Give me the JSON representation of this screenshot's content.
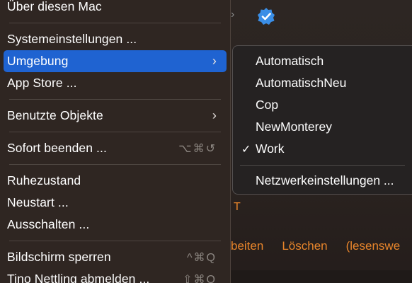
{
  "apple_menu": {
    "about": "Über diesen Mac",
    "system_settings": "Systemeinstellungen ...",
    "location": "Umgebung",
    "app_store": "App Store ...",
    "recent_items": "Benutzte Objekte",
    "force_quit": "Sofort beenden ...",
    "force_quit_shortcut": "⌥⌘↺",
    "sleep": "Ruhezustand",
    "restart": "Neustart ...",
    "shut_down": "Ausschalten ...",
    "lock_screen": "Bildschirm sperren",
    "lock_screen_shortcut": "^⌘Q",
    "log_out": "Tino Nettling abmelden ...",
    "log_out_shortcut": "⇧⌘Q"
  },
  "location_submenu": {
    "items": [
      "Automatisch",
      "AutomatischNeu",
      "Cop",
      "NewMonterey",
      "Work"
    ],
    "selected": "Work",
    "check_mark": "✓",
    "network_settings": "Netzwerkeinstellungen ..."
  },
  "background": {
    "orange_fragment": "T",
    "toolbar": [
      "beiten",
      "Löschen",
      "(lesenswe"
    ],
    "accent_color": "#e8852b",
    "badge_color": "#3a8ee6"
  }
}
